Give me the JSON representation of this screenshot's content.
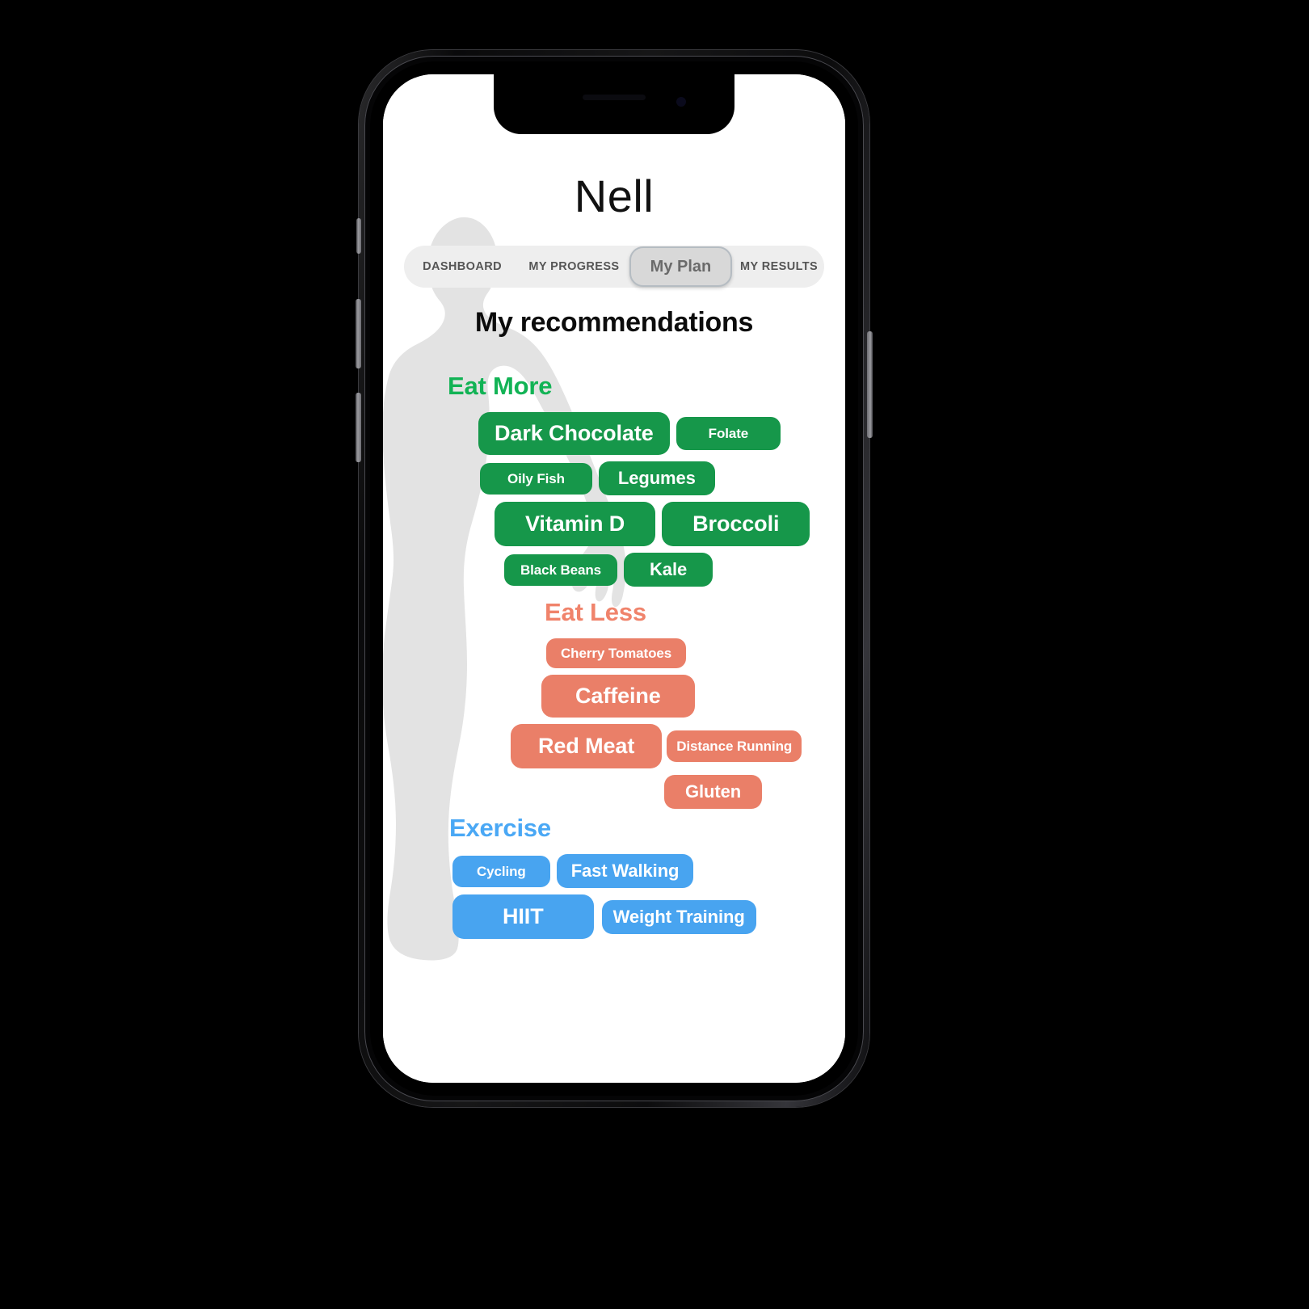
{
  "app": {
    "brand": "Nell",
    "page_title": "My recommendations"
  },
  "tabs": [
    {
      "key": "dashboard",
      "label": "DASHBOARD",
      "active": false
    },
    {
      "key": "my-progress",
      "label": "MY PROGRESS",
      "active": false
    },
    {
      "key": "my-plan",
      "label": "My Plan",
      "active": true
    },
    {
      "key": "my-results",
      "label": "MY RESULTS",
      "active": false
    }
  ],
  "sections": {
    "eat_more": {
      "heading": "Eat More",
      "color": "#12b355",
      "pill_color": "#16974a",
      "rows": [
        [
          {
            "label": "Dark Chocolate",
            "size": "lg"
          },
          {
            "label": "Folate",
            "size": "sm"
          }
        ],
        [
          {
            "label": "Oily Fish",
            "size": "sm"
          },
          {
            "label": "Legumes",
            "size": "md"
          }
        ],
        [
          {
            "label": "Vitamin D",
            "size": "lg"
          },
          {
            "label": "Broccoli",
            "size": "lg"
          }
        ],
        [
          {
            "label": "Black Beans",
            "size": "sm"
          },
          {
            "label": "Kale",
            "size": "md"
          }
        ]
      ]
    },
    "eat_less": {
      "heading": "Eat Less",
      "color": "#f0836b",
      "pill_color": "#ea7f68",
      "rows": [
        [
          {
            "label": "Cherry Tomatoes",
            "size": "sm"
          }
        ],
        [
          {
            "label": "Caffeine",
            "size": "lg"
          }
        ],
        [
          {
            "label": "Red Meat",
            "size": "lg"
          },
          {
            "label": "Distance Running",
            "size": "sm"
          }
        ],
        [
          {
            "label": "Gluten",
            "size": "md"
          }
        ]
      ]
    },
    "exercise": {
      "heading": "Exercise",
      "color": "#4aa8f5",
      "pill_color": "#48a4f0",
      "rows": [
        [
          {
            "label": "Cycling",
            "size": "sm"
          },
          {
            "label": "Fast Walking",
            "size": "md"
          }
        ],
        [
          {
            "label": "HIIT",
            "size": "lg"
          },
          {
            "label": "Weight Training",
            "size": "md"
          }
        ]
      ]
    }
  },
  "decor": {
    "silhouette_name": "human-body-silhouette",
    "silhouette_color": "#e3e3e3"
  }
}
